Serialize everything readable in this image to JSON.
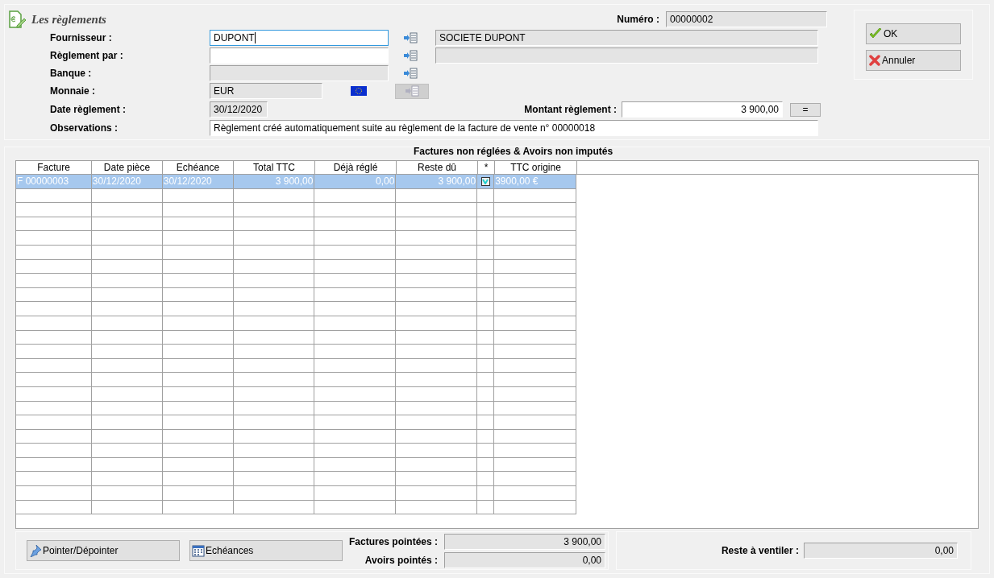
{
  "title": "Les règlements",
  "numero": {
    "label": "Numéro :",
    "value": "00000002"
  },
  "fields": [
    {
      "kind": "lookup",
      "label": "Fournisseur :",
      "value": "DUPONT",
      "focused": true,
      "editable": true,
      "detail_field": true,
      "detail": "SOCIETE DUPONT"
    },
    {
      "kind": "lookup",
      "label": "Règlement par :",
      "focused": false,
      "editable": true,
      "detail_field": true
    },
    {
      "kind": "lookup",
      "label": "Banque :",
      "focused": false,
      "editable": false,
      "detail_field": false
    },
    {
      "kind": "currency",
      "label": "Monnaie :",
      "value": "EUR"
    },
    {
      "kind": "date",
      "label": "Date règlement :",
      "value": "30/12/2020",
      "amount": {
        "label": "Montant règlement :",
        "value": "3 900,00",
        "button": "="
      }
    },
    {
      "kind": "text",
      "label": "Observations :",
      "value": "Règlement créé automatiquement suite au règlement de la facture de vente n° 00000018"
    }
  ],
  "actions": [
    {
      "kind": "ok",
      "label": "OK"
    },
    {
      "kind": "cancel",
      "label": "Annuler"
    }
  ],
  "table": {
    "title": "Factures non réglées & Avoirs non imputés",
    "columns": [
      "Facture",
      "Date pièce",
      "Echéance",
      "Total TTC",
      "Déjà réglé",
      "Reste dû",
      "*",
      "TTC origine"
    ],
    "rows": [
      {
        "cells": [
          "F 00000003",
          "30/12/2020",
          "30/12/2020",
          "3 900,00",
          "0,00",
          "3 900,00",
          "",
          "3900,00 €"
        ],
        "checked": true,
        "selected": true
      }
    ]
  },
  "bottom_buttons": [
    {
      "kind": "pin",
      "label": "Pointer/Dépointer"
    },
    {
      "kind": "calendar",
      "label": "Echéances"
    }
  ],
  "totals": [
    {
      "label": "Factures pointées :",
      "value": "3 900,00"
    },
    {
      "label": "Avoirs pointés :",
      "value": "0,00"
    }
  ],
  "reste": {
    "label": "Reste à ventiler :",
    "value": "0,00"
  }
}
